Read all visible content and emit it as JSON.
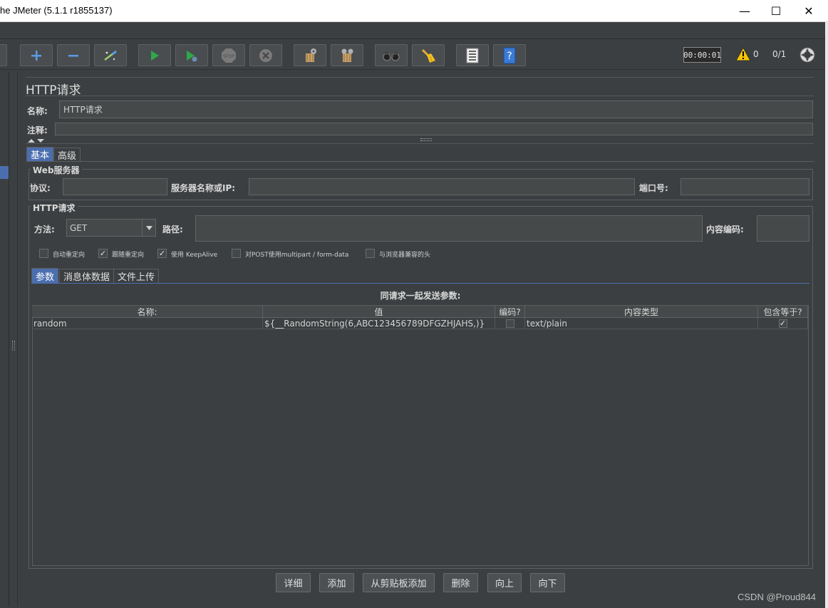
{
  "window": {
    "title": "he JMeter (5.1.1 r1855137)",
    "minimize": "—",
    "maximize": "☐",
    "close": "✕"
  },
  "toolbar": {
    "timer": "00:00:01",
    "warning_count": "0",
    "threads": "0/1",
    "icons": [
      "expand-all-icon",
      "collapse-all-icon",
      "toggle-icon",
      "start-icon",
      "start-no-pause-icon",
      "stop-icon",
      "shutdown-icon",
      "clear-icon",
      "clear-all-icon",
      "search-icon",
      "reset-search-icon",
      "function-helper-icon",
      "help-icon"
    ]
  },
  "panel": {
    "title": "HTTP请求",
    "name_label": "名称:",
    "name_value": "HTTP请求",
    "comment_label": "注释:",
    "comment_value": ""
  },
  "tabs": {
    "basic": "基本",
    "advanced": "高级"
  },
  "web_server": {
    "group_title": "Web服务器",
    "protocol_label": "协议:",
    "protocol_value": "",
    "server_label": "服务器名称或IP:",
    "server_value": "",
    "port_label": "端口号:",
    "port_value": ""
  },
  "http_request": {
    "group_title": "HTTP请求",
    "method_label": "方法:",
    "method_value": "GET",
    "path_label": "路径:",
    "path_value": "",
    "encoding_label": "内容编码:",
    "encoding_value": ""
  },
  "options": [
    {
      "label": "自动重定向",
      "checked": false
    },
    {
      "label": "跟随重定向",
      "checked": true
    },
    {
      "label": "使用 KeepAlive",
      "checked": true
    },
    {
      "label": "对POST使用multipart / form-data",
      "checked": false
    },
    {
      "label": "与浏览器兼容的头",
      "checked": false
    }
  ],
  "subtabs": {
    "params": "参数",
    "body": "消息体数据",
    "files": "文件上传"
  },
  "params_table": {
    "caption": "同请求一起发送参数:",
    "headers": [
      "名称:",
      "值",
      "编码?",
      "内容类型",
      "包含等于?"
    ],
    "rows": [
      {
        "name": "random",
        "value": "${__RandomString(6,ABC123456789DFGZHJAHS,)}",
        "encode": false,
        "content_type": "text/plain",
        "include_equals": true
      }
    ]
  },
  "buttons": {
    "detail": "详细",
    "add": "添加",
    "add_clipboard": "从剪贴板添加",
    "delete": "删除",
    "up": "向上",
    "down": "向下"
  },
  "watermark": "CSDN @Proud844",
  "colors": {
    "background": "#3c3f41",
    "selection": "#4b6eaf",
    "field": "#45494a"
  }
}
